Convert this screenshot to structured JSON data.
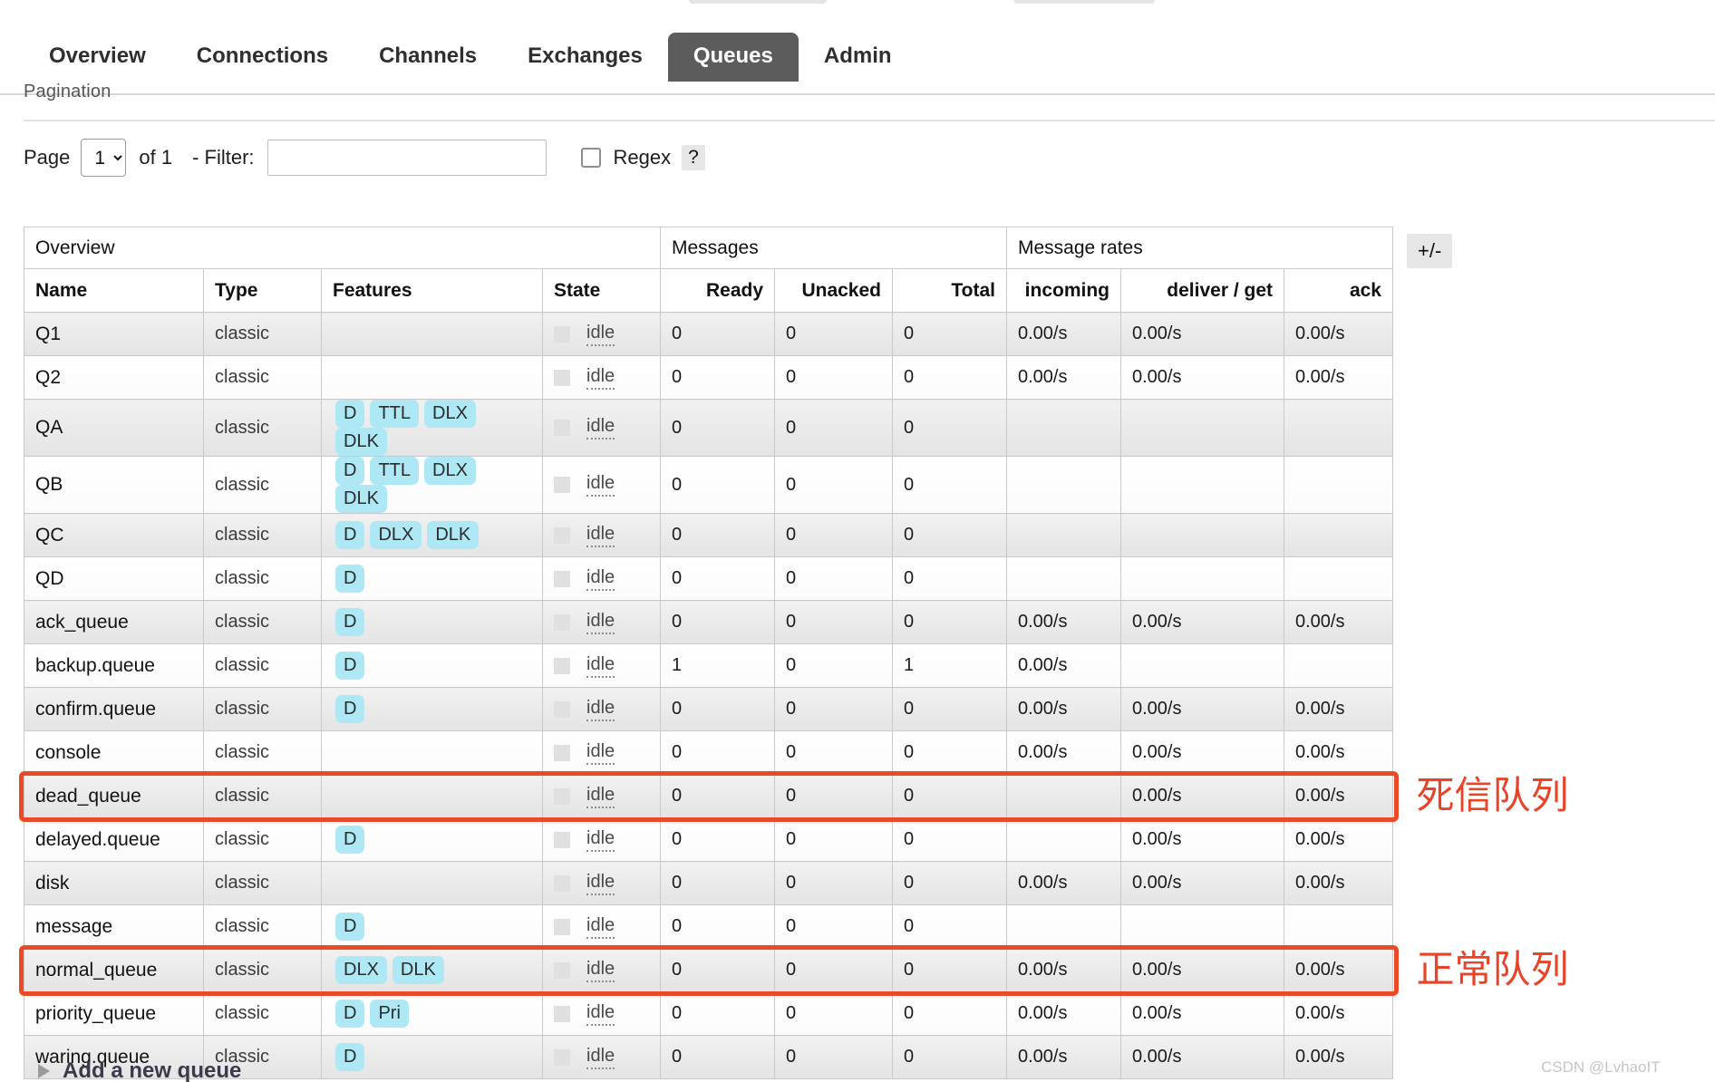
{
  "nav": {
    "tabs": [
      {
        "label": "Overview",
        "active": false
      },
      {
        "label": "Connections",
        "active": false
      },
      {
        "label": "Channels",
        "active": false
      },
      {
        "label": "Exchanges",
        "active": false
      },
      {
        "label": "Queues",
        "active": true
      },
      {
        "label": "Admin",
        "active": false
      }
    ]
  },
  "pagination": {
    "section_title": "Pagination",
    "page_label": "Page",
    "page_value": "1",
    "page_options": [
      "1"
    ],
    "of_label": "of 1",
    "filter_label": "- Filter:",
    "filter_value": "",
    "filter_placeholder": "",
    "regex_label": "Regex",
    "regex_checked": false,
    "help_label": "?"
  },
  "table": {
    "group_headers": [
      {
        "label": "Overview",
        "span": 4
      },
      {
        "label": "Messages",
        "span": 3
      },
      {
        "label": "Message rates",
        "span": 3
      }
    ],
    "columns": [
      "Name",
      "Type",
      "Features",
      "State",
      "Ready",
      "Unacked",
      "Total",
      "incoming",
      "deliver / get",
      "ack"
    ],
    "toggle_columns_label": "+/-",
    "state_value": "idle",
    "rows": [
      {
        "name": "Q1",
        "type": "classic",
        "features": [],
        "state": "idle",
        "ready": "0",
        "unacked": "0",
        "total": "0",
        "incoming": "0.00/s",
        "deliver_get": "0.00/s",
        "ack": "0.00/s"
      },
      {
        "name": "Q2",
        "type": "classic",
        "features": [],
        "state": "idle",
        "ready": "0",
        "unacked": "0",
        "total": "0",
        "incoming": "0.00/s",
        "deliver_get": "0.00/s",
        "ack": "0.00/s"
      },
      {
        "name": "QA",
        "type": "classic",
        "features": [
          "D",
          "TTL",
          "DLX",
          "DLK"
        ],
        "state": "idle",
        "ready": "0",
        "unacked": "0",
        "total": "0",
        "incoming": "",
        "deliver_get": "",
        "ack": ""
      },
      {
        "name": "QB",
        "type": "classic",
        "features": [
          "D",
          "TTL",
          "DLX",
          "DLK"
        ],
        "state": "idle",
        "ready": "0",
        "unacked": "0",
        "total": "0",
        "incoming": "",
        "deliver_get": "",
        "ack": ""
      },
      {
        "name": "QC",
        "type": "classic",
        "features": [
          "D",
          "DLX",
          "DLK"
        ],
        "state": "idle",
        "ready": "0",
        "unacked": "0",
        "total": "0",
        "incoming": "",
        "deliver_get": "",
        "ack": ""
      },
      {
        "name": "QD",
        "type": "classic",
        "features": [
          "D"
        ],
        "state": "idle",
        "ready": "0",
        "unacked": "0",
        "total": "0",
        "incoming": "",
        "deliver_get": "",
        "ack": ""
      },
      {
        "name": "ack_queue",
        "type": "classic",
        "features": [
          "D"
        ],
        "state": "idle",
        "ready": "0",
        "unacked": "0",
        "total": "0",
        "incoming": "0.00/s",
        "deliver_get": "0.00/s",
        "ack": "0.00/s"
      },
      {
        "name": "backup.queue",
        "type": "classic",
        "features": [
          "D"
        ],
        "state": "idle",
        "ready": "1",
        "unacked": "0",
        "total": "1",
        "incoming": "0.00/s",
        "deliver_get": "",
        "ack": ""
      },
      {
        "name": "confirm.queue",
        "type": "classic",
        "features": [
          "D"
        ],
        "state": "idle",
        "ready": "0",
        "unacked": "0",
        "total": "0",
        "incoming": "0.00/s",
        "deliver_get": "0.00/s",
        "ack": "0.00/s"
      },
      {
        "name": "console",
        "type": "classic",
        "features": [],
        "state": "idle",
        "ready": "0",
        "unacked": "0",
        "total": "0",
        "incoming": "0.00/s",
        "deliver_get": "0.00/s",
        "ack": "0.00/s"
      },
      {
        "name": "dead_queue",
        "type": "classic",
        "features": [],
        "state": "idle",
        "ready": "0",
        "unacked": "0",
        "total": "0",
        "incoming": "",
        "deliver_get": "0.00/s",
        "ack": "0.00/s",
        "highlighted": true
      },
      {
        "name": "delayed.queue",
        "type": "classic",
        "features": [
          "D"
        ],
        "state": "idle",
        "ready": "0",
        "unacked": "0",
        "total": "0",
        "incoming": "",
        "deliver_get": "0.00/s",
        "ack": "0.00/s"
      },
      {
        "name": "disk",
        "type": "classic",
        "features": [],
        "state": "idle",
        "ready": "0",
        "unacked": "0",
        "total": "0",
        "incoming": "0.00/s",
        "deliver_get": "0.00/s",
        "ack": "0.00/s"
      },
      {
        "name": "message",
        "type": "classic",
        "features": [
          "D"
        ],
        "state": "idle",
        "ready": "0",
        "unacked": "0",
        "total": "0",
        "incoming": "",
        "deliver_get": "",
        "ack": ""
      },
      {
        "name": "normal_queue",
        "type": "classic",
        "features": [
          "DLX",
          "DLK"
        ],
        "state": "idle",
        "ready": "0",
        "unacked": "0",
        "total": "0",
        "incoming": "0.00/s",
        "deliver_get": "0.00/s",
        "ack": "0.00/s",
        "highlighted": true
      },
      {
        "name": "priority_queue",
        "type": "classic",
        "features": [
          "D",
          "Pri"
        ],
        "state": "idle",
        "ready": "0",
        "unacked": "0",
        "total": "0",
        "incoming": "0.00/s",
        "deliver_get": "0.00/s",
        "ack": "0.00/s"
      },
      {
        "name": "waring.queue",
        "type": "classic",
        "features": [
          "D"
        ],
        "state": "idle",
        "ready": "0",
        "unacked": "0",
        "total": "0",
        "incoming": "0.00/s",
        "deliver_get": "0.00/s",
        "ack": "0.00/s"
      }
    ]
  },
  "annotations": [
    {
      "text": "死信队列",
      "color": "#e8442a"
    },
    {
      "text": "正常队列",
      "color": "#e8442a"
    }
  ],
  "footer": {
    "add_queue_label": "Add a new queue",
    "watermark": "CSDN @LvhaoIT"
  },
  "colors": {
    "active_tab_bg": "#5c5c5c",
    "badge_bg": "#aee8f5",
    "highlight": "#ea4a25",
    "annotation": "#e8442a"
  }
}
